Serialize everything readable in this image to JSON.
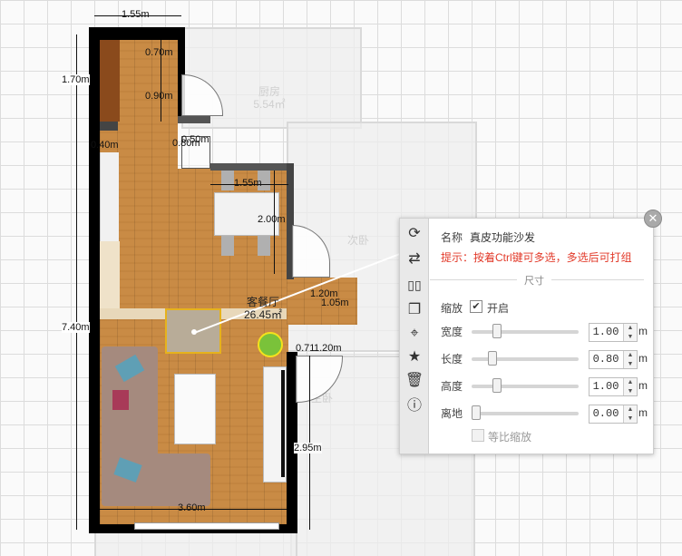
{
  "plan": {
    "rooms": {
      "living": {
        "name": "客餐厅",
        "area": "26.45㎡"
      },
      "kitchen": {
        "name": "厨房",
        "area": "5.54㎡"
      },
      "second_bedroom": {
        "name": "次卧",
        "area": ""
      },
      "master_bedroom": {
        "name": "主卧",
        "area": ""
      }
    },
    "dimensions": {
      "top_width": "1.55m",
      "left_top": "1.70m",
      "door_a": "0.70m",
      "door_b": "0.90m",
      "side_a": "0.40m",
      "side_b": "0.80m",
      "side_c": "0.50m",
      "dining_width": "1.55m",
      "dining_depth": "2.00m",
      "alcove_w": "1.20m",
      "alcove_h": "1.05m",
      "offset_a": "0.71",
      "offset_b": "1.20m",
      "left_total": "7.40m",
      "right_lower": "2.95m",
      "bottom_width": "3.60m"
    }
  },
  "panel": {
    "name_label": "名称",
    "name_value": "真皮功能沙发",
    "hint": "提示：按着Ctrl键可多选，多选后可打组",
    "section_title": "尺寸",
    "scale_label": "缩放",
    "scale_checkbox_label": "开启",
    "scale_checked": true,
    "rows": [
      {
        "label": "宽度",
        "value": "1.00",
        "unit": "m",
        "slider": 0.5
      },
      {
        "label": "长度",
        "value": "0.80",
        "unit": "m",
        "slider": 0.4
      },
      {
        "label": "高度",
        "value": "1.00",
        "unit": "m",
        "slider": 0.5
      },
      {
        "label": "离地",
        "value": "0.00",
        "unit": "m",
        "slider": 0.0
      }
    ],
    "proportional_label": "等比缩放",
    "proportional_checked": false
  },
  "toolbar": [
    {
      "icon": "rotate-icon"
    },
    {
      "icon": "swap-icon"
    },
    {
      "icon": "mirror-icon"
    },
    {
      "icon": "copy-icon"
    },
    {
      "icon": "position-icon"
    },
    {
      "icon": "favorite-icon"
    },
    {
      "icon": "delete-icon"
    },
    {
      "icon": "info-icon"
    }
  ],
  "colors": {
    "accent_hint": "#e23a2a",
    "wall": "#000000",
    "floor": "#c98b45"
  }
}
